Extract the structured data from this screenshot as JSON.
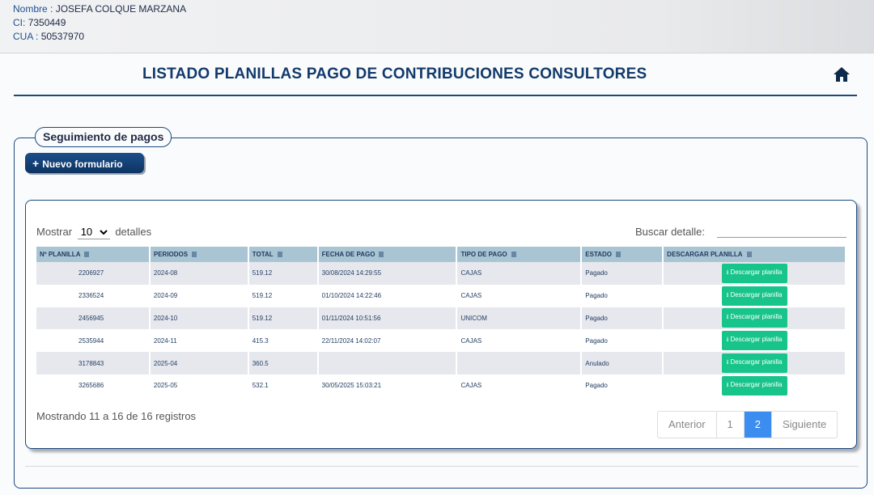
{
  "user": {
    "name_label": "Nombre :",
    "name": "JOSEFA COLQUE MARZANA",
    "ci_label": "CI:",
    "ci": "7350449",
    "cua_label": "CUA :",
    "cua": "50537970"
  },
  "header": {
    "title": "LISTADO PLANILLAS PAGO DE CONTRIBUCIONES CONSULTORES",
    "home_icon": "home-icon"
  },
  "section": {
    "legend": "Seguimiento de pagos",
    "new_button": "Nuevo formulario"
  },
  "table_controls": {
    "show_label": "Mostrar",
    "show_value": "10",
    "details_label": "detalles",
    "search_label": "Buscar detalle:",
    "search_value": ""
  },
  "table": {
    "columns": [
      "Nº PLANILLA",
      "PERIODOS",
      "TOTAL",
      "FECHA DE PAGO",
      "TIPO DE PAGO",
      "ESTADO",
      "DESCARGAR PLANILLA"
    ],
    "rows": [
      {
        "planilla": "2206927",
        "periodo": "2024-08",
        "total": "519.12",
        "fecha": "30/08/2024 14:29:55",
        "tipo": "CAJAS",
        "estado": "Pagado",
        "action": "Descargar planilla"
      },
      {
        "planilla": "2336524",
        "periodo": "2024-09",
        "total": "519.12",
        "fecha": "01/10/2024 14:22:46",
        "tipo": "CAJAS",
        "estado": "Pagado",
        "action": "Descargar planilla"
      },
      {
        "planilla": "2456945",
        "periodo": "2024-10",
        "total": "519.12",
        "fecha": "01/11/2024 10:51:56",
        "tipo": "UNICOM",
        "estado": "Pagado",
        "action": "Descargar planilla"
      },
      {
        "planilla": "2535944",
        "periodo": "2024-11",
        "total": "415.3",
        "fecha": "22/11/2024 14:02:07",
        "tipo": "CAJAS",
        "estado": "Pagado",
        "action": "Descargar planilla"
      },
      {
        "planilla": "3178843",
        "periodo": "2025-04",
        "total": "360.5",
        "fecha": "",
        "tipo": "",
        "estado": "Anulado",
        "action": "Descargar planilla"
      },
      {
        "planilla": "3265686",
        "periodo": "2025-05",
        "total": "532.1",
        "fecha": "30/05/2025 15:03:21",
        "tipo": "CAJAS",
        "estado": "Pagado",
        "action": "Descargar planilla"
      }
    ]
  },
  "footer": {
    "info": "Mostrando 11 a 16 de 16 registros",
    "pagination": [
      "Anterior",
      "1",
      "2",
      "Siguiente"
    ],
    "current_page": "2"
  },
  "colors": {
    "brand": "#123a6b",
    "accent": "#3b8ef0",
    "download": "#17c48a"
  }
}
